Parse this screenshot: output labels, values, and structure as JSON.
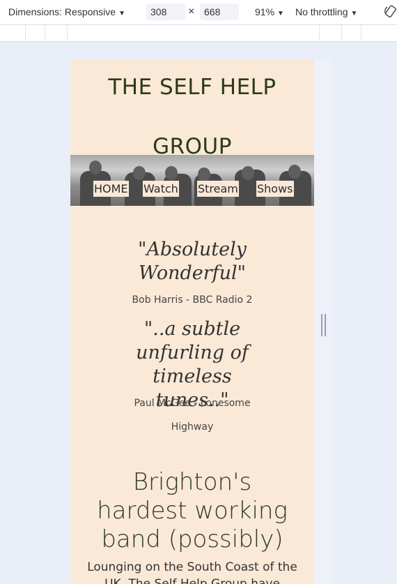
{
  "devtools": {
    "dimensions_label": "Dimensions: Responsive",
    "width": "308",
    "times": "×",
    "height": "668",
    "zoom": "91%",
    "throttling": "No throttling",
    "caret": "▼"
  },
  "site": {
    "title_line1": "THE SELF HELP",
    "title_line2": "GROUP",
    "nav": [
      "HOME",
      "Watch",
      "Stream",
      "Shows"
    ],
    "quotes": [
      {
        "text": "\"Absolutely Wonderful\"",
        "attribution": "Bob Harris - BBC Radio 2"
      },
      {
        "text": "\"..a subtle unfurling of timeless tunes..\"",
        "attribution_line1": "Paul McGee - Lonesome",
        "attribution_line2": "Highway"
      }
    ],
    "headline": "Brighton's hardest working band (possibly)",
    "body": "Lounging on the South Coast of the UK, The Self Help Group have"
  },
  "colors": {
    "page_bg": "#fae9d7",
    "title": "#2c3b16",
    "devtools_bg": "#e9eef8"
  }
}
